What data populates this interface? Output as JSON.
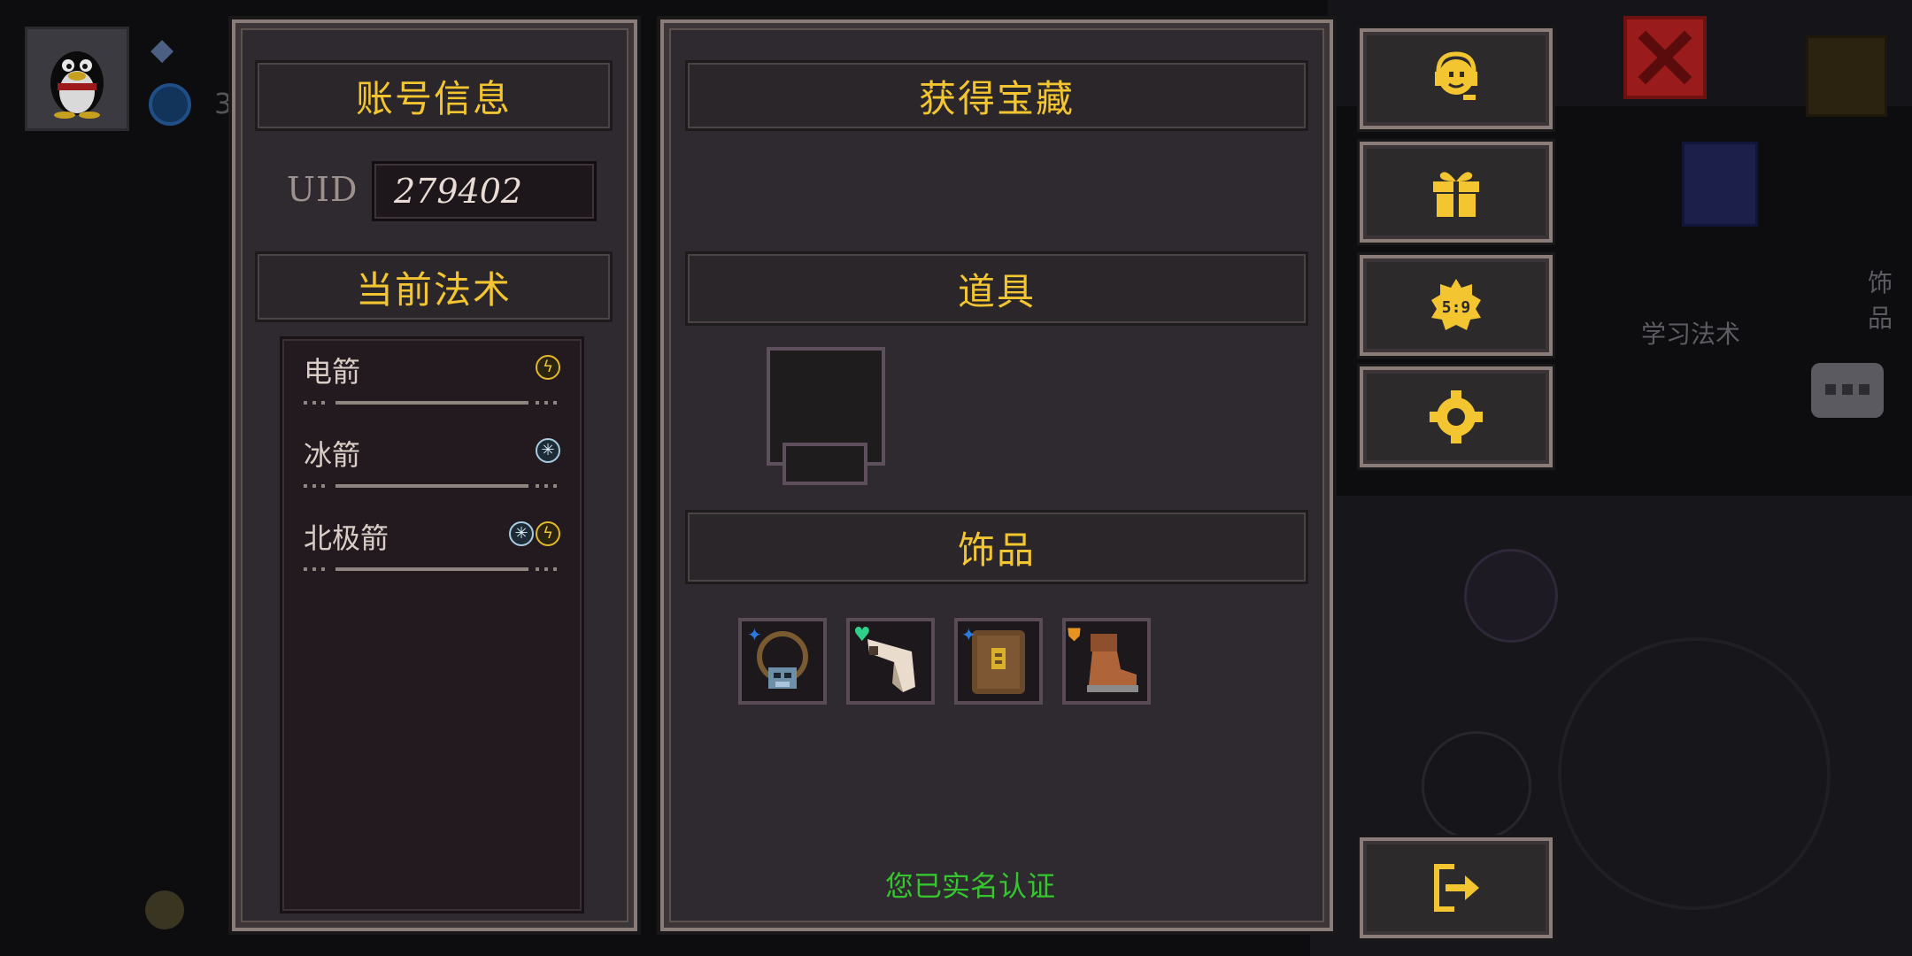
{
  "background": {
    "coin_count_partial": "3",
    "accessory_label_partial": "饰品",
    "learn_spell_label": "学习法术"
  },
  "account_panel": {
    "title": "账号信息",
    "uid_label": "UID",
    "uid_value": "279402",
    "spells_title": "当前法术",
    "spells": [
      {
        "name": "电箭",
        "elements": [
          "lightning"
        ]
      },
      {
        "name": "冰箭",
        "elements": [
          "ice"
        ]
      },
      {
        "name": "北极箭",
        "elements": [
          "ice",
          "lightning"
        ]
      }
    ]
  },
  "treasure_panel": {
    "title": "获得宝藏",
    "items_title": "道具",
    "accessories_title": "饰品",
    "accessories": [
      {
        "icon": "amulet-icon",
        "badge": "blue-star"
      },
      {
        "icon": "scroll-icon",
        "badge": "green-heart"
      },
      {
        "icon": "backpack-icon",
        "badge": "blue-star"
      },
      {
        "icon": "boot-icon",
        "badge": "orange-shield"
      }
    ],
    "verified_text": "您已实名认证"
  },
  "side_buttons": [
    {
      "icon": "customer-service-icon"
    },
    {
      "icon": "gift-icon"
    },
    {
      "icon": "code-icon"
    },
    {
      "icon": "settings-icon"
    },
    {
      "icon": "logout-icon"
    }
  ],
  "colors": {
    "accent_gold": "#f2c531",
    "verified_green": "#35c52f",
    "panel_bg": "#2e2a2f"
  }
}
